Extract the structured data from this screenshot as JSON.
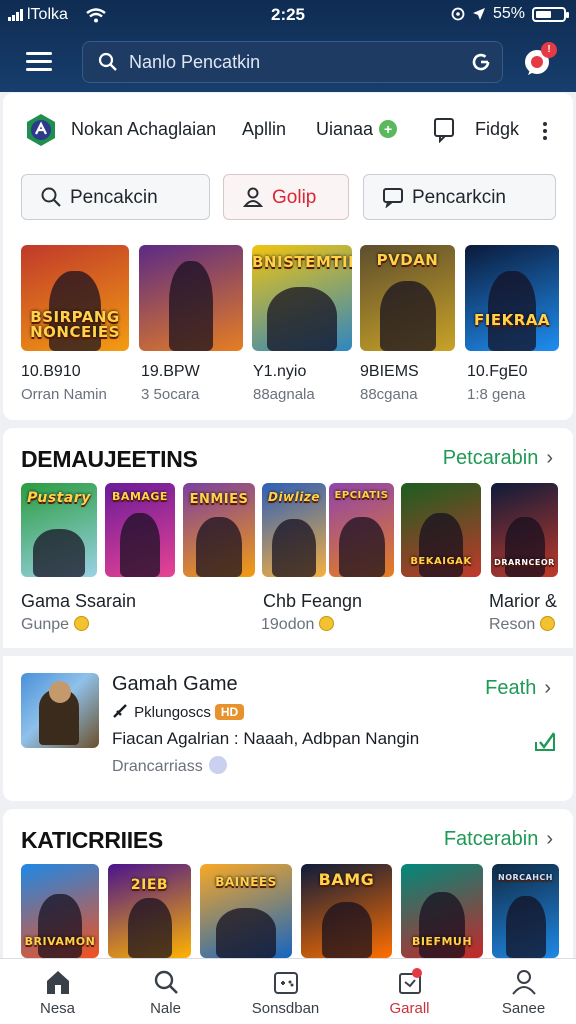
{
  "status_bar": {
    "carrier": "lTolka",
    "time": "2:25",
    "battery": "55%"
  },
  "header": {
    "search_placeholder": "Nanlo Pencatkin"
  },
  "notifications": {
    "badge": "!"
  },
  "app_bar": {
    "title": "Nokan Achaglaian",
    "tabs": [
      "Apllin",
      "Uianaa"
    ],
    "right_label": "Fidgk"
  },
  "pills": [
    "Pencakcin",
    "Golip",
    "Pencarkcin"
  ],
  "top_games": [
    {
      "banner": "BSIRPANG NONCEIES",
      "title": "10.B910",
      "sub": "Orran Namin",
      "colors": [
        "#c0392b",
        "#f39c12"
      ]
    },
    {
      "banner": "",
      "title": "19.BPW",
      "sub": "3 5ocara",
      "colors": [
        "#5b2a86",
        "#e67e22"
      ]
    },
    {
      "banner": "BNISTEMTIHY",
      "title": "Y1.nyio",
      "sub": "88agnala",
      "colors": [
        "#f1c40f",
        "#2e86c1"
      ]
    },
    {
      "banner": "PVDAN",
      "title": "9BIEMS",
      "sub": "88cgana",
      "colors": [
        "#5d4e2e",
        "#c9a227"
      ]
    },
    {
      "banner": "FIEKRAA",
      "title": "10.FgE0",
      "sub": "1:8 gena",
      "colors": [
        "#0b1a3a",
        "#1f8ef1"
      ]
    }
  ],
  "section_1": {
    "title": "DEMAUJEETINS",
    "link": "Petcarabin",
    "tiles": [
      {
        "banner": "Pustary",
        "colors": [
          "#2a9d3f",
          "#9bd1e5"
        ]
      },
      {
        "banner": "BAMAGE",
        "colors": [
          "#6a1b9a",
          "#e84393"
        ]
      },
      {
        "banner": "ENMIES",
        "colors": [
          "#7b3fa0",
          "#f39c12"
        ]
      },
      {
        "banner": "Diwlize",
        "colors": [
          "#2d5fb8",
          "#f5b041"
        ]
      },
      {
        "banner": "EPCIATIS",
        "colors": [
          "#8e44ad",
          "#e67e22"
        ]
      },
      {
        "banner": "BEKAIGAK",
        "colors": [
          "#1b5e20",
          "#c0392b"
        ]
      },
      {
        "banner": "DRARNCEOR",
        "colors": [
          "#0d1b3a",
          "#c0392b"
        ]
      }
    ],
    "captions": [
      {
        "name": "Gama Ssarain",
        "sub": "Gunpe"
      },
      {
        "name": "Chb Feangn",
        "sub": "19odon"
      },
      {
        "name": "Marior &",
        "sub": "Reson"
      }
    ]
  },
  "featured": {
    "title": "Gamah Game",
    "tag": "Pklungoscs",
    "tag_badge": "HD",
    "description": "Fiacan Agalrian : Naaah, Adbpan Nangin",
    "sub": "Drancarriass",
    "link": "Feath"
  },
  "section_2": {
    "title": "KATICRRIIES",
    "link": "Fatcerabin",
    "tiles": [
      {
        "banner": "BRIVAMON",
        "colors": [
          "#1e88e5",
          "#f4511e"
        ]
      },
      {
        "banner": "2IEB",
        "colors": [
          "#4a148c",
          "#ffb300"
        ]
      },
      {
        "banner": "BAINEES",
        "colors": [
          "#f9a825",
          "#1565c0"
        ]
      },
      {
        "banner": "BAMG",
        "colors": [
          "#0d1b3a",
          "#ff6f00"
        ]
      },
      {
        "banner": "BIEFMUH",
        "colors": [
          "#00897b",
          "#c62828"
        ]
      },
      {
        "banner": "NORCAHCH",
        "colors": [
          "#102a43",
          "#1e88e5"
        ]
      }
    ]
  },
  "bottom_nav": {
    "items": [
      "Nesa",
      "Nale",
      "Sonsdban",
      "Garall",
      "Sanee"
    ],
    "active_index": 3
  }
}
